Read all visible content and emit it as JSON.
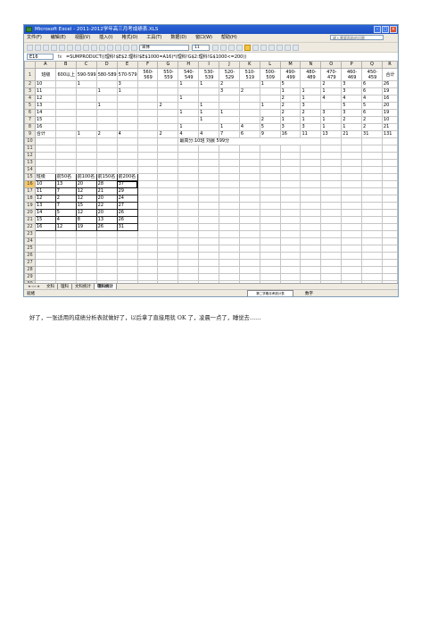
{
  "window": {
    "title": "Microsoft Excel - 2011-2012学年高三月考成绩表.XLS"
  },
  "menu": {
    "items": [
      "文件(F)",
      "编辑(E)",
      "视图(V)",
      "插入(I)",
      "格式(O)",
      "工具(T)",
      "数据(D)",
      "窗口(W)",
      "帮助(H)"
    ],
    "help_placeholder": "键入需要帮助的问题"
  },
  "toolbar": {
    "font_name": "宋体",
    "font_size": "11",
    "tools": [
      "new-icon",
      "open-icon",
      "save-icon",
      "print-icon",
      "preview-icon",
      "spell-icon",
      "cut-icon",
      "copy-icon",
      "paste-icon",
      "undo-icon",
      "redo-icon",
      "sum-icon",
      "sort-icon",
      "chart-icon",
      "zoom-icon",
      "bold-icon",
      "italic-icon",
      "underline-icon",
      "align-left-icon",
      "align-center-icon",
      "align-right-icon",
      "merge-icon",
      "percent-icon",
      "border-icon",
      "fill-color-icon",
      "font-color-icon"
    ]
  },
  "formula_bar": {
    "name_box": "E16",
    "fx": "fx",
    "formula": "=SUMPRODUCT((理科!$E$2:理科!$E$1000=A16)*(理科!G$2:理科!G$1000<=200))"
  },
  "sheet": {
    "columns": [
      "A",
      "B",
      "C",
      "D",
      "E",
      "F",
      "G",
      "H",
      "I",
      "J",
      "K",
      "L",
      "M",
      "N",
      "O",
      "P",
      "Q",
      "R"
    ],
    "header_row": [
      "班级",
      "600以上",
      "590-599",
      "580-589",
      "570-579",
      "560-569",
      "550-559",
      "540-549",
      "530-539",
      "520-529",
      "510-519",
      "500-509",
      "490-499",
      "480-489",
      "470-479",
      "460-469",
      "450-459",
      "合计"
    ],
    "data_rows": [
      {
        "row": "2",
        "cells": [
          "10",
          "",
          "1",
          "",
          "3",
          "",
          "",
          "1",
          "1",
          "2",
          "",
          "1",
          "5",
          "",
          "2",
          "3",
          "6",
          "26"
        ]
      },
      {
        "row": "3",
        "cells": [
          "11",
          "",
          "",
          "1",
          "1",
          "",
          "",
          "",
          "",
          "3",
          "2",
          "",
          "1",
          "1",
          "1",
          "3",
          "6",
          "19"
        ]
      },
      {
        "row": "4",
        "cells": [
          "12",
          "",
          "",
          "",
          "",
          "",
          "",
          "1",
          "",
          "",
          "",
          "",
          "2",
          "1",
          "4",
          "4",
          "4",
          "16"
        ]
      },
      {
        "row": "5",
        "cells": [
          "13",
          "",
          "",
          "1",
          "",
          "",
          "2",
          "",
          "1",
          "",
          "",
          "1",
          "2",
          "3",
          "",
          "5",
          "5",
          "20"
        ]
      },
      {
        "row": "6",
        "cells": [
          "14",
          "",
          "",
          "",
          "",
          "",
          "",
          "1",
          "1",
          "1",
          "",
          "",
          "2",
          "2",
          "3",
          "3",
          "6",
          "19"
        ]
      },
      {
        "row": "7",
        "cells": [
          "15",
          "",
          "",
          "",
          "",
          "",
          "",
          "",
          "1",
          "",
          "",
          "2",
          "1",
          "1",
          "1",
          "2",
          "2",
          "10"
        ]
      },
      {
        "row": "8",
        "cells": [
          "16",
          "",
          "",
          "",
          "",
          "",
          "",
          "1",
          "",
          "1",
          "4",
          "5",
          "3",
          "3",
          "1",
          "1",
          "2",
          "21"
        ]
      },
      {
        "row": "9",
        "cells": [
          "合计",
          "",
          "1",
          "2",
          "4",
          "",
          "2",
          "4",
          "4",
          "7",
          "6",
          "9",
          "16",
          "11",
          "13",
          "21",
          "31",
          "131"
        ]
      }
    ],
    "row10_text": "最高分:10班   刘晨   599分",
    "summary": {
      "header_row_num": "15",
      "headers": [
        "班级",
        "前50名",
        "前100名",
        "前150名",
        "前200名"
      ],
      "rows": [
        {
          "row": "16",
          "cells": [
            "10",
            "13",
            "20",
            "28",
            "37"
          ]
        },
        {
          "row": "17",
          "cells": [
            "11",
            "7",
            "12",
            "21",
            "29"
          ]
        },
        {
          "row": "18",
          "cells": [
            "12",
            "2",
            "12",
            "20",
            "24"
          ]
        },
        {
          "row": "19",
          "cells": [
            "13",
            "7",
            "15",
            "22",
            "27"
          ]
        },
        {
          "row": "20",
          "cells": [
            "14",
            "5",
            "12",
            "20",
            "26"
          ]
        },
        {
          "row": "21",
          "cells": [
            "15",
            "4",
            "8",
            "13",
            "26"
          ]
        },
        {
          "row": "22",
          "cells": [
            "16",
            "12",
            "19",
            "26",
            "31"
          ]
        }
      ]
    },
    "empty_rows": [
      "10",
      "11",
      "12",
      "13",
      "14",
      "23",
      "24",
      "25",
      "26",
      "27",
      "28",
      "29",
      "30",
      "31"
    ]
  },
  "sheet_tabs": [
    "文科",
    "理科",
    "文科统计",
    "理科统计"
  ],
  "active_tab": "理科统计",
  "status": {
    "ready": "就绪",
    "mode": "数字",
    "hint": "第二学期月考统计表"
  },
  "caption": "好了，一张适用的成绩分析表就做好了，以后拿了直接用就 OK 了，凌晨一点了，睡觉去……"
}
